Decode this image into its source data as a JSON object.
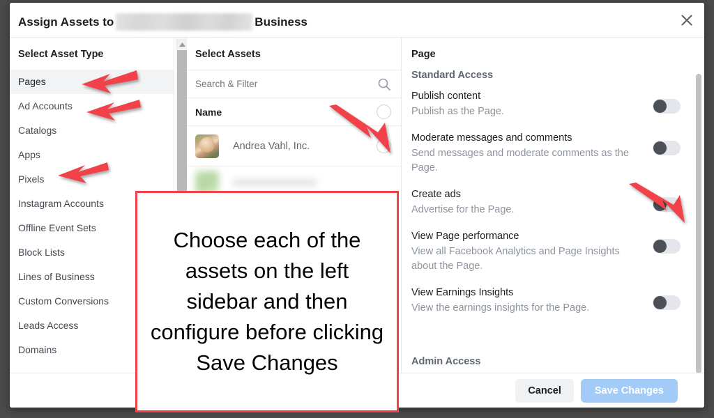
{
  "dialog": {
    "title_prefix": "Assign Assets to",
    "title_redacted": "",
    "title_suffix": "Business",
    "close_icon": "close-icon"
  },
  "asset_types": {
    "heading": "Select Asset Type",
    "items": [
      {
        "label": "Pages",
        "selected": true
      },
      {
        "label": "Ad Accounts",
        "selected": false
      },
      {
        "label": "Catalogs",
        "selected": false
      },
      {
        "label": "Apps",
        "selected": false
      },
      {
        "label": "Pixels",
        "selected": false
      },
      {
        "label": "Instagram Accounts",
        "selected": false
      },
      {
        "label": "Offline Event Sets",
        "selected": false
      },
      {
        "label": "Block Lists",
        "selected": false
      },
      {
        "label": "Lines of Business",
        "selected": false
      },
      {
        "label": "Custom Conversions",
        "selected": false
      },
      {
        "label": "Leads Access",
        "selected": false
      },
      {
        "label": "Domains",
        "selected": false
      }
    ]
  },
  "assets": {
    "heading": "Select Assets",
    "search_placeholder": "Search & Filter",
    "search_value": "",
    "search_icon": "search-icon",
    "column_header": "Name",
    "rows": [
      {
        "name": "Andrea Vahl, Inc.",
        "selected": false
      },
      {
        "name": "",
        "selected": false
      }
    ]
  },
  "permissions": {
    "heading": "Page",
    "section_standard": "Standard Access",
    "section_admin": "Admin Access",
    "items": [
      {
        "name": "Publish content",
        "desc": "Publish as the Page.",
        "on": false
      },
      {
        "name": "Moderate messages and comments",
        "desc": "Send messages and moderate comments as the Page.",
        "on": false
      },
      {
        "name": "Create ads",
        "desc": "Advertise for the Page.",
        "on": false
      },
      {
        "name": "View Page performance",
        "desc": "View all Facebook Analytics and Page Insights about the Page.",
        "on": false
      },
      {
        "name": "View Earnings Insights",
        "desc": "View the earnings insights for the Page.",
        "on": false
      }
    ]
  },
  "footer": {
    "cancel_label": "Cancel",
    "save_label": "Save Changes"
  },
  "annotation": {
    "text": "Choose each of the assets on the left sidebar and then configure before clicking Save Changes",
    "border_color": "#f3414a",
    "arrow_color": "#f3414a"
  },
  "colors": {
    "accent_blue": "#1b78f2",
    "save_button": "#a3cbf7",
    "toggle_track": "#e4e6eb",
    "toggle_knob": "#4b4f56",
    "page_backdrop": "#4a4a4a"
  }
}
